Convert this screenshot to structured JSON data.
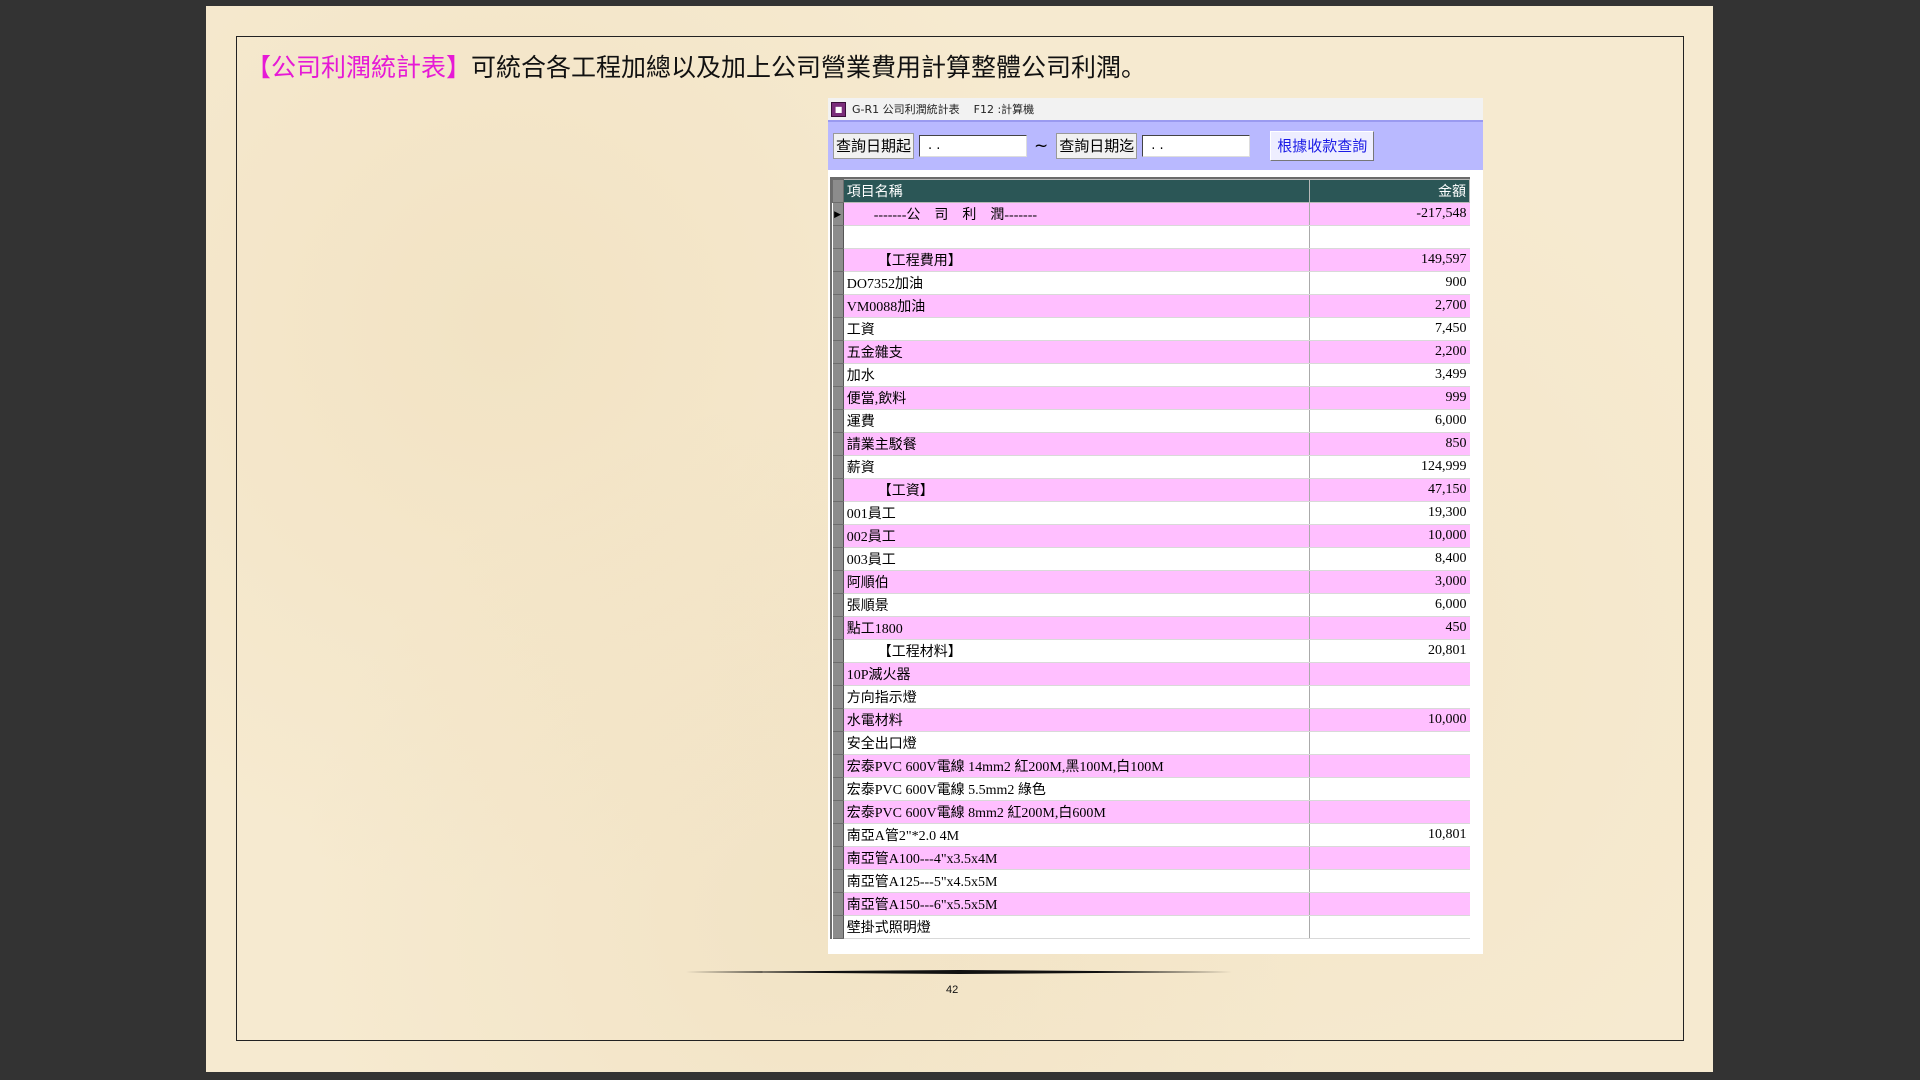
{
  "heading": {
    "highlight": "【公司利潤統計表】",
    "text": "可統合各工程加總以及加上公司營業費用計算整體公司利潤。"
  },
  "window": {
    "title": "G-R1 公司利潤統計表",
    "shortcut": "F12 :計算機"
  },
  "toolbar": {
    "start_label": "查詢日期起",
    "start_value": " .  . ",
    "tilde": "~",
    "end_label": "查詢日期迄",
    "end_value": " .  . ",
    "query_button": "根據收款查詢"
  },
  "grid": {
    "columns": [
      "項目名稱",
      "金額"
    ],
    "rows": [
      {
        "name": "-------公　司　利　潤-------",
        "amount": "-217,548",
        "kind": "top"
      },
      {
        "name": "",
        "amount": "",
        "kind": "plain"
      },
      {
        "name": "【工程費用】",
        "amount": "149,597",
        "kind": "sec"
      },
      {
        "name": "DO7352加油",
        "amount": "900",
        "kind": "plain"
      },
      {
        "name": "VM0088加油",
        "amount": "2,700",
        "kind": "plain"
      },
      {
        "name": "工資",
        "amount": "7,450",
        "kind": "plain"
      },
      {
        "name": "五金雜支",
        "amount": "2,200",
        "kind": "plain"
      },
      {
        "name": "加水",
        "amount": "3,499",
        "kind": "plain"
      },
      {
        "name": "便當,飲料",
        "amount": "999",
        "kind": "plain"
      },
      {
        "name": "運費",
        "amount": "6,000",
        "kind": "plain"
      },
      {
        "name": "請業主駁餐",
        "amount": "850",
        "kind": "plain"
      },
      {
        "name": "薪資",
        "amount": "124,999",
        "kind": "plain"
      },
      {
        "name": "【工資】",
        "amount": "47,150",
        "kind": "sec"
      },
      {
        "name": "001員工",
        "amount": "19,300",
        "kind": "plain"
      },
      {
        "name": "002員工",
        "amount": "10,000",
        "kind": "plain"
      },
      {
        "name": "003員工",
        "amount": "8,400",
        "kind": "plain"
      },
      {
        "name": "阿順伯",
        "amount": "3,000",
        "kind": "plain"
      },
      {
        "name": "張順景",
        "amount": "6,000",
        "kind": "plain"
      },
      {
        "name": "點工1800",
        "amount": "450",
        "kind": "plain"
      },
      {
        "name": "【工程材料】",
        "amount": "20,801",
        "kind": "sec"
      },
      {
        "name": "10P滅火器",
        "amount": "",
        "kind": "plain"
      },
      {
        "name": "方向指示燈",
        "amount": "",
        "kind": "plain"
      },
      {
        "name": "水電材料",
        "amount": "10,000",
        "kind": "plain"
      },
      {
        "name": "安全出口燈",
        "amount": "",
        "kind": "plain"
      },
      {
        "name": "宏泰PVC 600V電線 14mm2 紅200M,黑100M,白100M",
        "amount": "",
        "kind": "plain"
      },
      {
        "name": "宏泰PVC 600V電線 5.5mm2 綠色",
        "amount": "",
        "kind": "plain"
      },
      {
        "name": "宏泰PVC 600V電線 8mm2 紅200M,白600M",
        "amount": "",
        "kind": "plain"
      },
      {
        "name": "南亞A管2\"*2.0 4M",
        "amount": "10,801",
        "kind": "plain"
      },
      {
        "name": "南亞管A100---4\"x3.5x4M",
        "amount": "",
        "kind": "plain"
      },
      {
        "name": "南亞管A125---5\"x4.5x5M",
        "amount": "",
        "kind": "plain"
      },
      {
        "name": "南亞管A150---6\"x5.5x5M",
        "amount": "",
        "kind": "plain"
      },
      {
        "name": "壁掛式照明燈",
        "amount": "",
        "kind": "plain"
      }
    ]
  },
  "footer": {
    "page_number": "42"
  },
  "colors": {
    "highlight": "#e619d6",
    "row_pink": "#ffbfff",
    "header_bg": "#2b5656",
    "toolbar_bg": "#b9b9ff",
    "page_bg": "#f6ead0"
  },
  "icons": {
    "app": "app-icon",
    "row_pointer": "current-row-pointer-icon"
  }
}
